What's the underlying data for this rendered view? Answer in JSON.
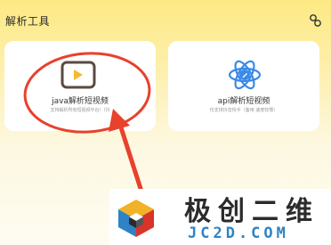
{
  "header": {
    "title": "解析工具",
    "action_icon": "settings-nodes-icon"
  },
  "cards": [
    {
      "icon": "video-play-icon",
      "title": "java解析短视频",
      "desc": "支持解析所有短视频平台!（抖"
    },
    {
      "icon": "atom-icon",
      "title": "api解析短视频",
      "desc": "仅支持抖音快手（备用 速度较慢）"
    }
  ],
  "annotation": {
    "color": "#e8412c"
  },
  "watermark": {
    "cn_text": "极创二维",
    "en_text": "JC2D.COM"
  },
  "colors": {
    "play_icon_stroke": "#5a4a42",
    "play_triangle": "#f5b82e",
    "atom_blue": "#3a8ae8",
    "brand_blue": "#2d83c5"
  }
}
